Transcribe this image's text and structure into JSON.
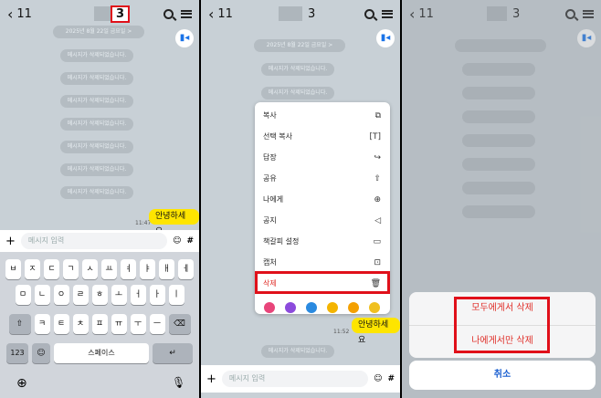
{
  "panel1": {
    "back_label": "11",
    "title_count": "3",
    "date_pill": "2025년 8월 22일 금요일 >",
    "deleted_msg": "메시지가 삭제되었습니다.",
    "bubble": "안녕하세요",
    "time": "11:47",
    "input_placeholder": "메시지 입력",
    "plus": "+",
    "hash": "#",
    "kb_row1": [
      "ㅂ",
      "ㅈ",
      "ㄷ",
      "ㄱ",
      "ㅅ",
      "ㅛ",
      "ㅕ",
      "ㅑ",
      "ㅐ",
      "ㅔ"
    ],
    "kb_row2": [
      "ㅁ",
      "ㄴ",
      "ㅇ",
      "ㄹ",
      "ㅎ",
      "ㅗ",
      "ㅓ",
      "ㅏ",
      "ㅣ"
    ],
    "kb_row3": [
      "ㅋ",
      "ㅌ",
      "ㅊ",
      "ㅍ",
      "ㅠ",
      "ㅜ",
      "ㅡ"
    ],
    "kb_num": "123",
    "kb_space": "스페이스"
  },
  "panel2": {
    "back_label": "11",
    "title_count": "3",
    "date_pill": "2025년 8월 22일 금요일 >",
    "deleted_msg": "메시지가 삭제되었습니다.",
    "menu": [
      {
        "label": "복사",
        "icon": "⧉"
      },
      {
        "label": "선택 복사",
        "icon": "[T]"
      },
      {
        "label": "답장",
        "icon": "↪"
      },
      {
        "label": "공유",
        "icon": "⇧"
      },
      {
        "label": "나에게",
        "icon": "⊕"
      },
      {
        "label": "공지",
        "icon": "◁"
      },
      {
        "label": "책갈피 설정",
        "icon": "▭"
      },
      {
        "label": "캡처",
        "icon": "⊡"
      },
      {
        "label": "삭제",
        "icon": "🗑"
      }
    ],
    "bubble": "안녕하세요",
    "time": "11:52",
    "input_placeholder": "메시지 입력"
  },
  "panel3": {
    "back_label": "11",
    "title_count": "3",
    "delete_all": "모두에게서 삭제",
    "delete_me": "나에게서만 삭제",
    "cancel": "취소"
  },
  "colors": {
    "accent_red": "#e0101a",
    "kakao_yellow": "#fee500",
    "bg": "#c8d0d6"
  }
}
